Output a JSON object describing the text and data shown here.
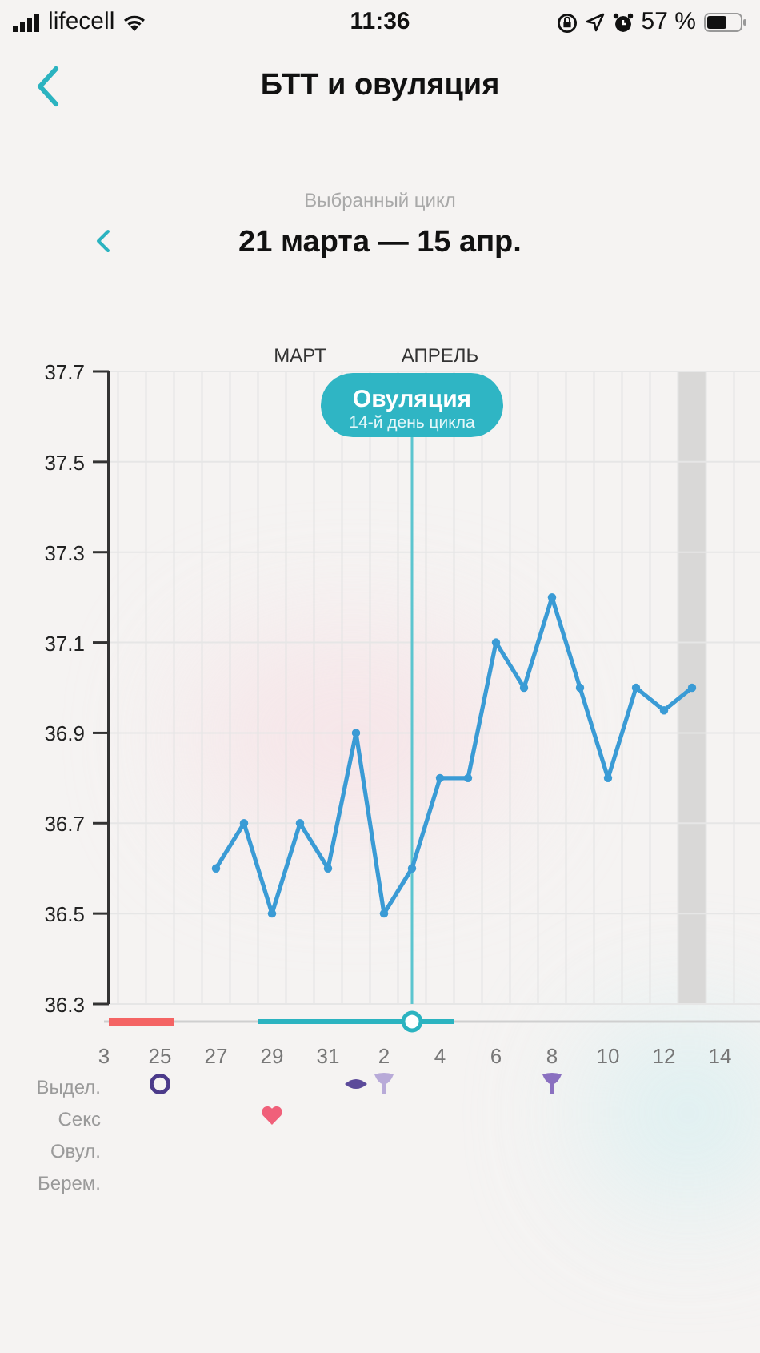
{
  "status_bar": {
    "carrier": "lifecell",
    "time": "11:36",
    "battery": "57 %"
  },
  "nav": {
    "title": "БТТ и овуляция"
  },
  "cycle": {
    "caption": "Выбранный цикл",
    "range": "21 марта — 15 апр."
  },
  "chart": {
    "chart_data": {
      "type": "line",
      "categories": [
        "3",
        null,
        "25",
        null,
        "27",
        null,
        "29",
        null,
        "31",
        null,
        "2",
        null,
        "4",
        null,
        "6",
        null,
        "8",
        null,
        "10",
        null,
        "12",
        null,
        "14",
        null
      ],
      "grid": true,
      "series": [
        {
          "color": "#3a9bd5",
          "marker": true,
          "values": [
            null,
            null,
            null,
            null,
            36.6,
            36.7,
            36.5,
            36.7,
            36.6,
            36.9,
            36.5,
            36.6,
            36.8,
            36.8,
            37.1,
            37.0,
            37.2,
            37.0,
            36.8,
            37.0,
            36.95,
            37.0,
            null,
            null
          ]
        }
      ],
      "ylim": [
        36.3,
        37.7
      ],
      "yticks": [
        37.7,
        37.5,
        37.3,
        37.1,
        36.9,
        36.7,
        36.5,
        36.3
      ]
    },
    "months": [
      {
        "label": "МАРТ"
      },
      {
        "label": "АПРЕЛЬ"
      }
    ],
    "ovulation": {
      "title": "Овуляция",
      "subtitle": "14-й день цикла"
    },
    "rows": [
      {
        "label": "Выдел.",
        "marks": [
          {
            "kind": "ring"
          },
          {
            "kind": "lips"
          },
          {
            "kind": "flower-light"
          },
          {
            "kind": "flower"
          }
        ]
      },
      {
        "label": "Секс",
        "marks": [
          {
            "kind": "heart"
          }
        ]
      },
      {
        "label": "Овул.",
        "marks": []
      },
      {
        "label": "Берем.",
        "marks": []
      }
    ]
  }
}
